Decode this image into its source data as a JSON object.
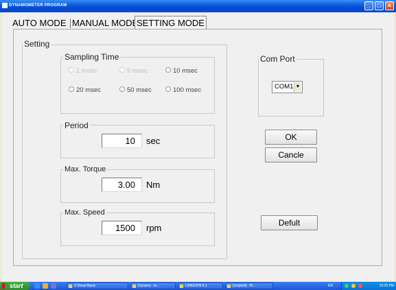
{
  "window": {
    "title": "DYNAMOMETER PROGRAM"
  },
  "tabs": [
    {
      "label": "AUTO MODE"
    },
    {
      "label": "MANUAL MODE"
    },
    {
      "label": "SETTING MODE",
      "selected": true
    }
  ],
  "setting": {
    "group_label": "Setting",
    "sampling": {
      "label": "Sampling Time",
      "options": [
        {
          "label": "1 msec",
          "enabled": false
        },
        {
          "label": "5 msec",
          "enabled": false
        },
        {
          "label": "10 msec",
          "enabled": true
        },
        {
          "label": "20 msec",
          "enabled": true
        },
        {
          "label": "50 msec",
          "enabled": true
        },
        {
          "label": "100 msec",
          "enabled": true
        }
      ]
    },
    "period": {
      "label": "Period",
      "value": "10",
      "unit": "sec"
    },
    "torque": {
      "label": "Max. Torque",
      "value": "3.00",
      "unit": "Nm"
    },
    "speed": {
      "label": "Max. Speed",
      "value": "1500",
      "unit": "rpm"
    }
  },
  "com_port": {
    "label": "Com Port",
    "value": "COM1"
  },
  "buttons": {
    "ok": "OK",
    "cancel": "Cancle",
    "default": "Defult"
  },
  "taskbar": {
    "start": "start",
    "tasks": [
      "3 Visual Basic",
      "Dynamo - w...",
      "LINKEDIN 6.1",
      "[scripted] - Pi..."
    ],
    "language": "EN",
    "clock": "10:25 PM"
  },
  "colors": {
    "titlebar": "#0a5ee0",
    "taskbar": "#245edb",
    "start": "#3c9d37",
    "window_bg": "#f0f0f0"
  }
}
